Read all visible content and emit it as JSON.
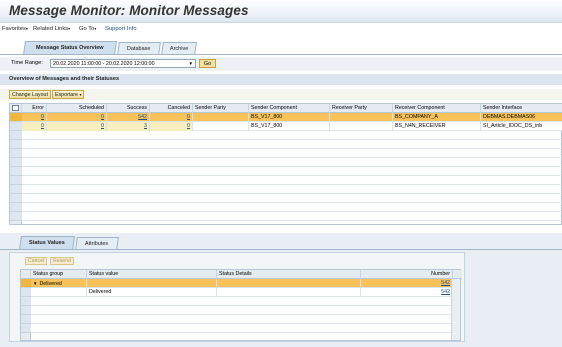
{
  "page": {
    "title": "Message Monitor: Monitor Messages"
  },
  "menu": {
    "favorites": "Favorites",
    "related_links": "Related Links",
    "go_to": "Go To",
    "support_info": "Support Info"
  },
  "tabs_top": [
    {
      "label": "Message Status Overview",
      "active": true
    },
    {
      "label": "Database",
      "active": false
    },
    {
      "label": "Archive",
      "active": false
    }
  ],
  "time_range": {
    "label": "Time Range:",
    "value": "20.02.2020 11:00:00 - 20.02.2020 12:00:00",
    "go_label": "Go"
  },
  "overview": {
    "header": "Overview of Messages and their Statuses",
    "change_layout_label": "Change Layout",
    "export_label": "Esportare",
    "columns": [
      "Error",
      "Scheduled",
      "Success",
      "Canceled",
      "Sender Party",
      "Sender Component",
      "Receiver Party",
      "Receiver Component",
      "Sender Interface"
    ],
    "rows": [
      {
        "error": "0",
        "scheduled": "0",
        "success": "542",
        "canceled": "0",
        "sender_party": "",
        "sender_component": "BS_V17_800",
        "receiver_party": "",
        "receiver_component": "BS_COMPANY_A",
        "sender_interface": "DEBMAS.DEBMAS06"
      },
      {
        "error": "0",
        "scheduled": "0",
        "success": "3",
        "canceled": "0",
        "sender_party": "",
        "sender_component": "BS_V17_800",
        "receiver_party": "",
        "receiver_component": "BS_N4N_RECEIVER",
        "sender_interface": "SI_Article_IDOC_DS_inb"
      }
    ]
  },
  "tabs_bottom": [
    {
      "label": "Status Values",
      "active": true
    },
    {
      "label": "Attributes",
      "active": false
    }
  ],
  "status_values": {
    "cancel_label": "Cancel",
    "resend_label": "Resend",
    "columns": [
      "Status group",
      "Status value",
      "Status Details",
      "Number"
    ],
    "rows": [
      {
        "group": "Delivered",
        "value": "",
        "details": "",
        "number": "542"
      },
      {
        "group": "",
        "value": "Delivered",
        "details": "",
        "number": "542"
      }
    ]
  },
  "colors": {
    "selected_row": "#f8c25a",
    "link": "#1f4f86",
    "header_bg": "#e5ebf1"
  }
}
